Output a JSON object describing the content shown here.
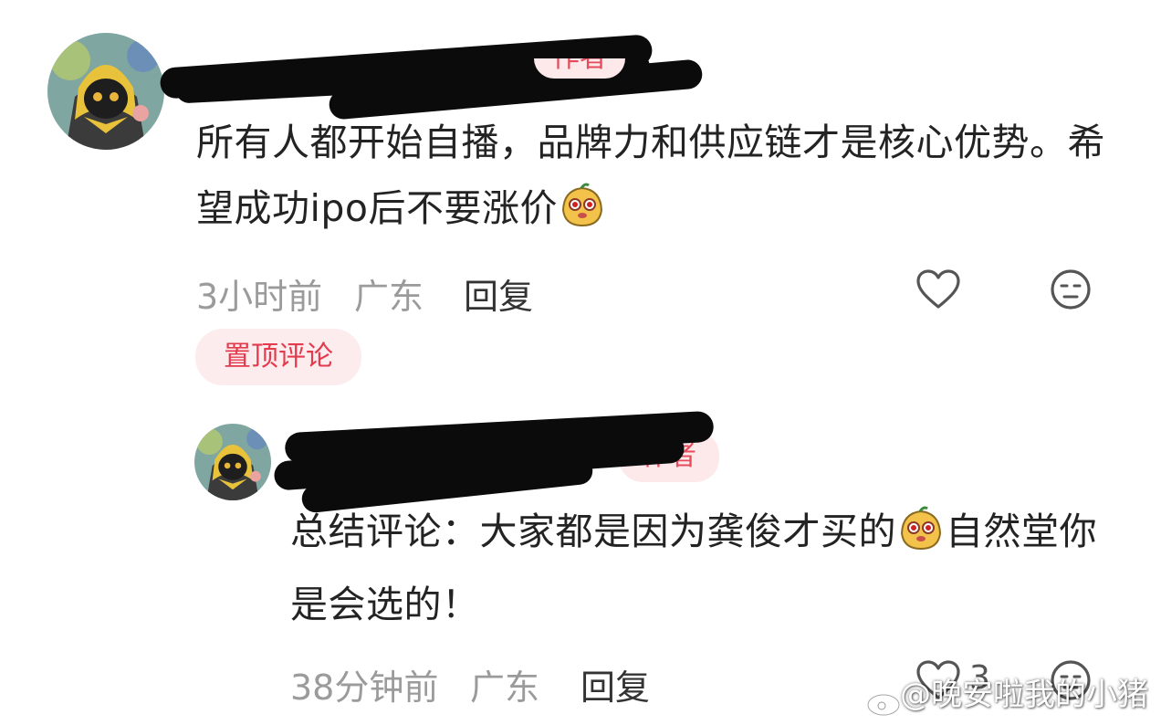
{
  "comments": [
    {
      "author_badge": "作者",
      "content": "所有人都开始自播，品牌力和供应链才是核心优势。希望成功ipo后不要涨价",
      "time": "3小时前",
      "location": "广东",
      "reply_label": "回复",
      "pinned_label": "置顶评论"
    },
    {
      "author_badge": "作者",
      "content_part1": "总结评论：大家都是因为龚俊才买的",
      "content_part2": "自然堂你是会选的！",
      "time": "38分钟前",
      "location": "广东",
      "reply_label": "回复",
      "like_count": "3"
    }
  ],
  "watermark": "@晚安啦我的小猪"
}
